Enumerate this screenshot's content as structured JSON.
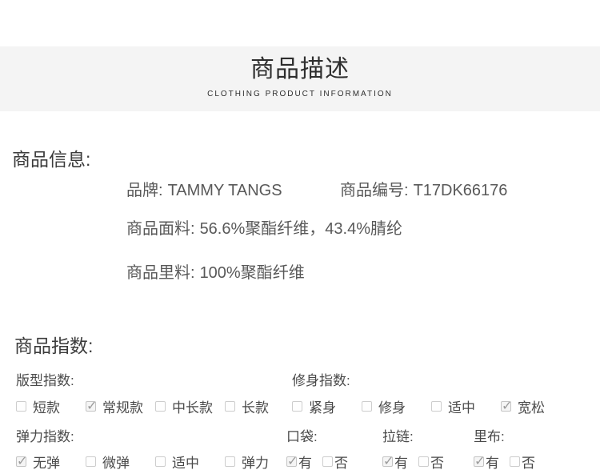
{
  "header": {
    "title": "商品描述",
    "subtitle": "CLOTHING PRODUCT INFORMATION"
  },
  "product_info": {
    "heading": "商品信息:",
    "brand_label": "品牌:",
    "brand_value": "TAMMY TANGS",
    "sku_label": "商品编号:",
    "sku_value": "T17DK66176",
    "fabric_label": "商品面料:",
    "fabric_value": "56.6%聚酯纤维，43.4%腈纶",
    "lining_label": "商品里料:",
    "lining_value": "100%聚酯纤维"
  },
  "product_index": {
    "heading": "商品指数:",
    "fit": {
      "label": "版型指数:",
      "options": [
        {
          "label": "短款",
          "checked": false
        },
        {
          "label": "常规款",
          "checked": true
        },
        {
          "label": "中长款",
          "checked": false
        },
        {
          "label": "长款",
          "checked": false
        }
      ]
    },
    "slim": {
      "label": "修身指数:",
      "options": [
        {
          "label": "紧身",
          "checked": false
        },
        {
          "label": "修身",
          "checked": false
        },
        {
          "label": "适中",
          "checked": false
        },
        {
          "label": "宽松",
          "checked": true
        }
      ]
    },
    "stretch": {
      "label": "弹力指数:",
      "options": [
        {
          "label": "无弹",
          "checked": true
        },
        {
          "label": "微弹",
          "checked": false
        },
        {
          "label": "适中",
          "checked": false
        },
        {
          "label": "弹力",
          "checked": false
        }
      ]
    },
    "pocket": {
      "label": "口袋:",
      "options": [
        {
          "label": "有",
          "checked": true
        },
        {
          "label": "否",
          "checked": false
        }
      ]
    },
    "zipper": {
      "label": "拉链:",
      "options": [
        {
          "label": "有",
          "checked": true
        },
        {
          "label": "否",
          "checked": false
        }
      ]
    },
    "lining": {
      "label": "里布:",
      "options": [
        {
          "label": "有",
          "checked": true
        },
        {
          "label": "否",
          "checked": false
        }
      ]
    }
  },
  "colors": {
    "band_bg": "#f4f4f4",
    "heading_text": "#3b3b3b",
    "body_text": "#595959",
    "label_text": "#4a4a4a",
    "checkbox_border": "#cdcdcd",
    "check_mark": "#9b9b9b"
  }
}
